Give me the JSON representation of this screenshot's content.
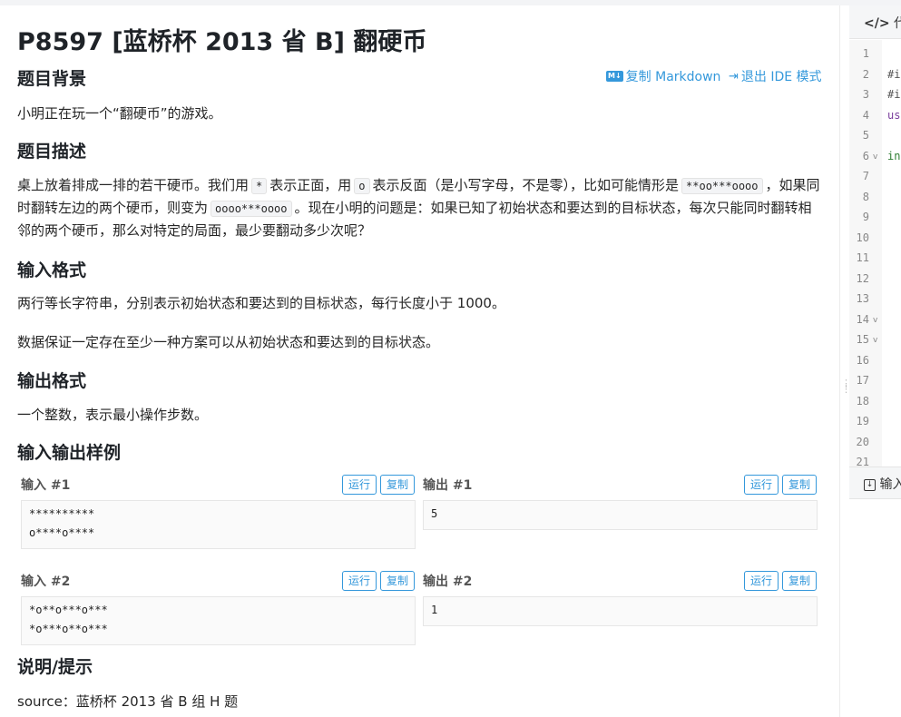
{
  "problem": {
    "title": "P8597 [蓝桥杯 2013 省 B] 翻硬币",
    "copy_markdown": "复制 Markdown",
    "md_badge": "M↓",
    "exit_ide": "退出 IDE 模式"
  },
  "sections": {
    "background": {
      "heading": "题目背景",
      "text": "小明正在玩一个“翻硬币”的游戏。"
    },
    "description": {
      "heading": "题目描述",
      "t1": "桌上放着排成一排的若干硬币。我们用",
      "c1": "*",
      "t2": "表示正面，用",
      "c2": "o",
      "t3": "表示反面（是小写字母，不是零），比如可能情形是",
      "c3": "**oo***oooo",
      "t4": "，如果同时翻转左边的两个硬币，则变为",
      "c4": "oooo***oooo",
      "t5": "。现在小明的问题是：如果已知了初始状态和要达到的目标状态，每次只能同时翻转相邻的两个硬币，那么对特定的局面，最少要翻动多少次呢？"
    },
    "input_format": {
      "heading": "输入格式",
      "p1": "两行等长字符串，分别表示初始状态和要达到的目标状态，每行长度小于 1000。",
      "p2": "数据保证一定存在至少一种方案可以从初始状态和要达到的目标状态。"
    },
    "output_format": {
      "heading": "输出格式",
      "p1": "一个整数，表示最小操作步数。"
    },
    "samples": {
      "heading": "输入输出样例",
      "run": "运行",
      "copy": "复制",
      "in1_label": "输入 #1",
      "in1": "**********\no****o****",
      "out1_label": "输出 #1",
      "out1": "5",
      "in2_label": "输入 #2",
      "in2": "*o**o***o***\n*o***o**o***",
      "out2_label": "输出 #2",
      "out2": "1"
    },
    "hint": {
      "heading": "说明/提示",
      "text": "source：蓝桥杯 2013 省 B 组 H 题"
    }
  },
  "ide": {
    "tab_icon": "</>",
    "tab_label": "代",
    "line_numbers": [
      "1",
      "2",
      "3",
      "4",
      "5",
      "6",
      "7",
      "8",
      "9",
      "10",
      "11",
      "12",
      "13",
      "14",
      "15",
      "16",
      "17",
      "18",
      "19",
      "20",
      "21"
    ],
    "code_fragments": {
      "l2": "#i",
      "l3": "#i",
      "l4": "us",
      "l6": "in"
    },
    "bottom_tab_label": "输入"
  },
  "colors": {
    "accent": "#3498db",
    "keyword": "#7a3e9d",
    "type": "#2e7d32"
  }
}
